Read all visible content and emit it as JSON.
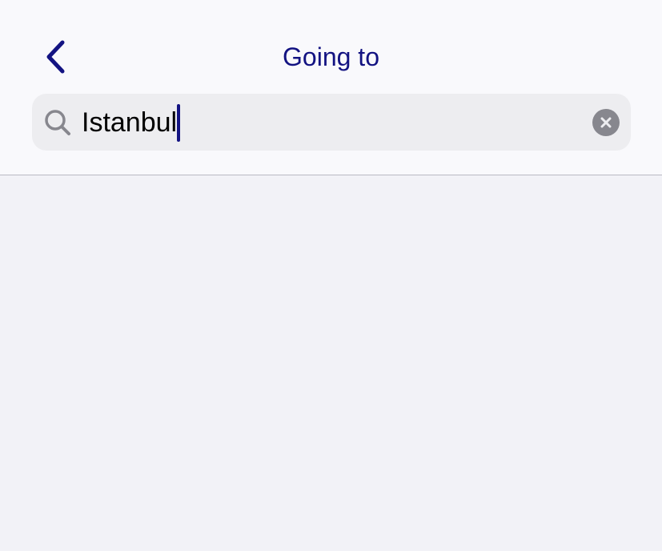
{
  "header": {
    "title": "Going to",
    "back_icon": "chevron-left-icon"
  },
  "search": {
    "value": "Istanbul",
    "search_icon": "search-icon",
    "clear_icon": "clear-circle-icon"
  },
  "colors": {
    "accent": "#131382",
    "header_bg": "#f9f9fc",
    "page_bg": "#f2f2f7",
    "search_bg": "#ededf0",
    "icon_gray": "#87878e"
  }
}
